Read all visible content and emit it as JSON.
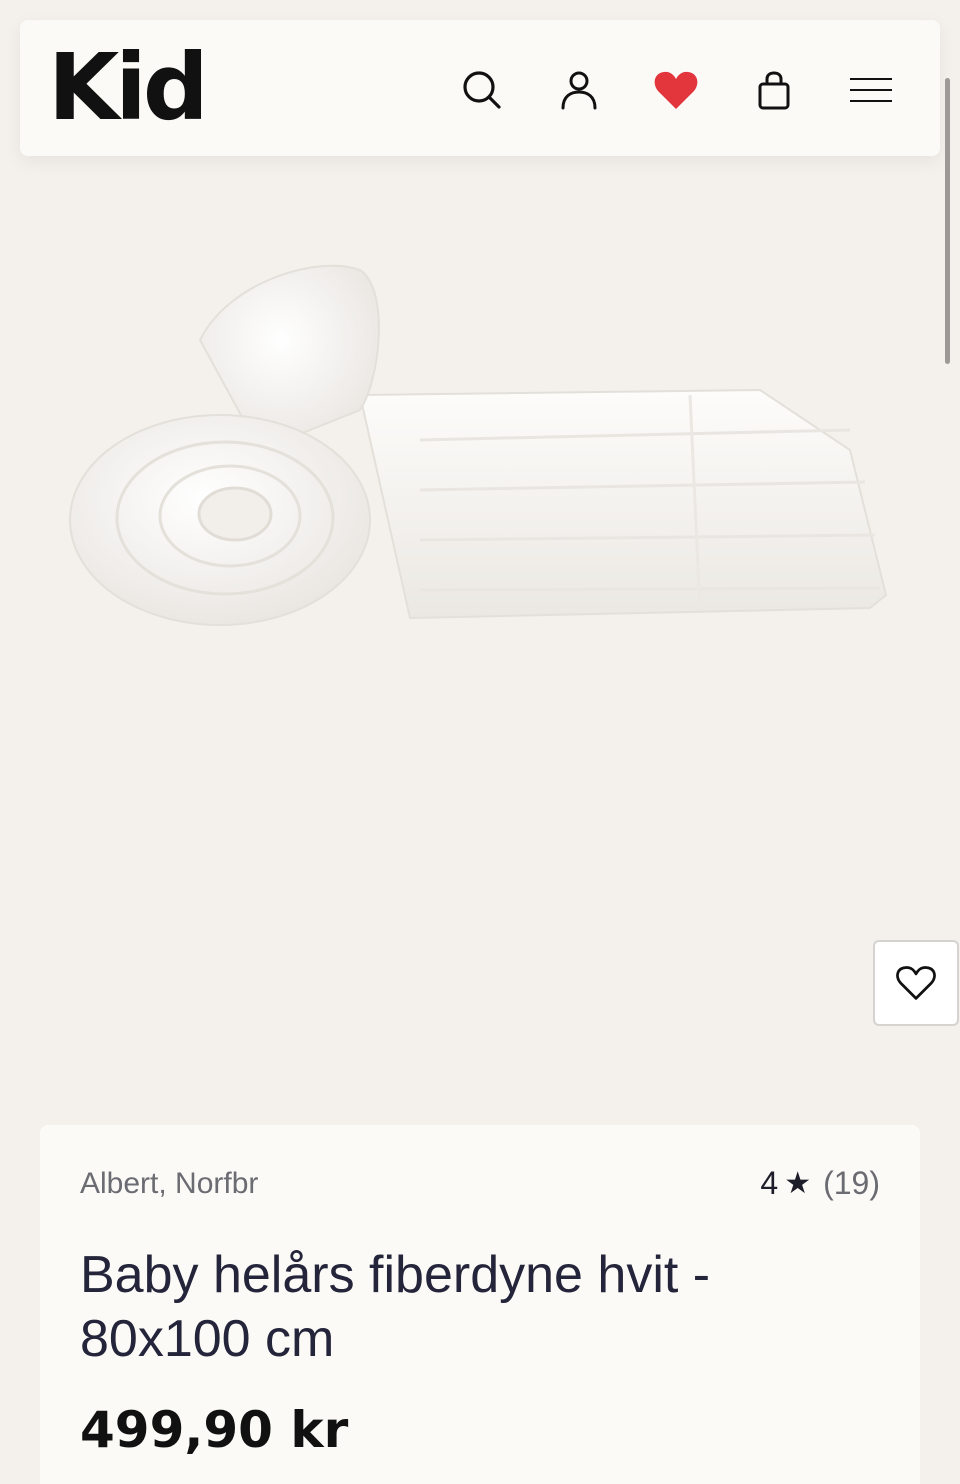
{
  "header": {
    "logo": "Kid",
    "icons": {
      "search": "search-icon",
      "account": "account-icon",
      "wishlist": "heart-filled-icon",
      "cart": "bag-icon",
      "menu": "hamburger-menu-icon"
    },
    "wishlist_color": "#e2353c"
  },
  "product": {
    "brand": "Albert, Norfbr",
    "rating_value": "4",
    "rating_star": "★",
    "rating_count": "(19)",
    "title": "Baby helårs fiberdyne hvit - 80x100 cm",
    "price": "499,90 kr",
    "wishlist_icon": "heart-outline-icon"
  }
}
